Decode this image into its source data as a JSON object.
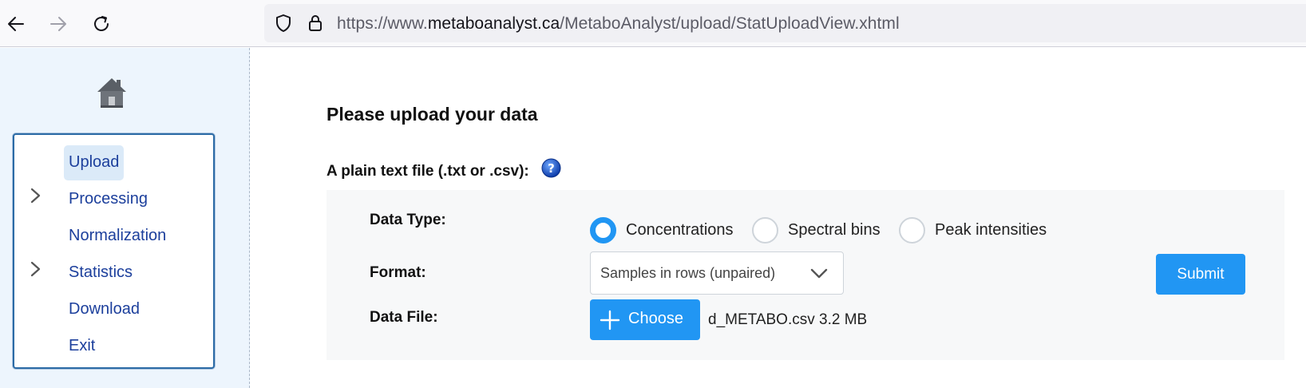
{
  "browser": {
    "url_prefix": "https://www.",
    "url_host": "metaboanalyst.ca",
    "url_path": "/MetaboAnalyst/upload/StatUploadView.xhtml"
  },
  "sidebar": {
    "items": [
      {
        "label": "Upload",
        "expandable": false,
        "active": true
      },
      {
        "label": "Processing",
        "expandable": true,
        "active": false
      },
      {
        "label": "Normalization",
        "expandable": false,
        "active": false
      },
      {
        "label": "Statistics",
        "expandable": true,
        "active": false
      },
      {
        "label": "Download",
        "expandable": false,
        "active": false
      },
      {
        "label": "Exit",
        "expandable": false,
        "active": false
      }
    ]
  },
  "main": {
    "title": "Please upload your data",
    "subtitle": "A plain text file (.txt or .csv):",
    "form": {
      "data_type_label": "Data Type:",
      "data_type_options": [
        "Concentrations",
        "Spectral bins",
        "Peak intensities"
      ],
      "data_type_selected": "Concentrations",
      "format_label": "Format:",
      "format_value": "Samples in rows (unpaired)",
      "data_file_label": "Data File:",
      "choose_label": "Choose",
      "file_info": "d_METABO.csv 3.2 MB",
      "submit_label": "Submit"
    }
  },
  "colors": {
    "accent": "#2196f3",
    "menu_text": "#1c3f9c",
    "sidebar_bg": "#edf5fd",
    "panel_bg": "#f7f8f9"
  },
  "icons": [
    "back-arrow-icon",
    "forward-arrow-icon",
    "reload-icon",
    "shield-icon",
    "lock-icon",
    "home-icon",
    "chevron-right-icon",
    "help-icon",
    "chevron-down-icon",
    "plus-icon"
  ]
}
